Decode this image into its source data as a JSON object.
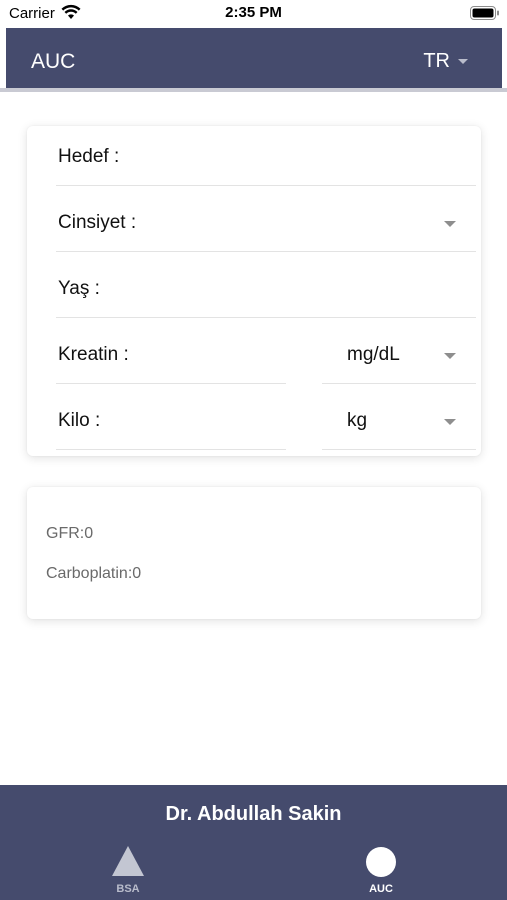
{
  "status_bar": {
    "carrier": "Carrier",
    "time": "2:35 PM"
  },
  "header": {
    "title": "AUC",
    "language": "TR",
    "background_color": "#454b6d"
  },
  "form": {
    "target_label": "Hedef :",
    "gender_label": "Cinsiyet :",
    "age_label": "Yaş :",
    "creatinine_label": "Kreatin :",
    "creatinine_unit": "mg/dL",
    "weight_label": "Kilo :",
    "weight_unit": "kg"
  },
  "results": {
    "gfr": "GFR:0",
    "carboplatin": "Carboplatin:0"
  },
  "footer": {
    "author": "Dr. Abdullah Sakin",
    "tabs": [
      {
        "label": "BSA",
        "icon": "triangle-icon",
        "active": false
      },
      {
        "label": "AUC",
        "icon": "circle-icon",
        "active": true
      }
    ]
  }
}
